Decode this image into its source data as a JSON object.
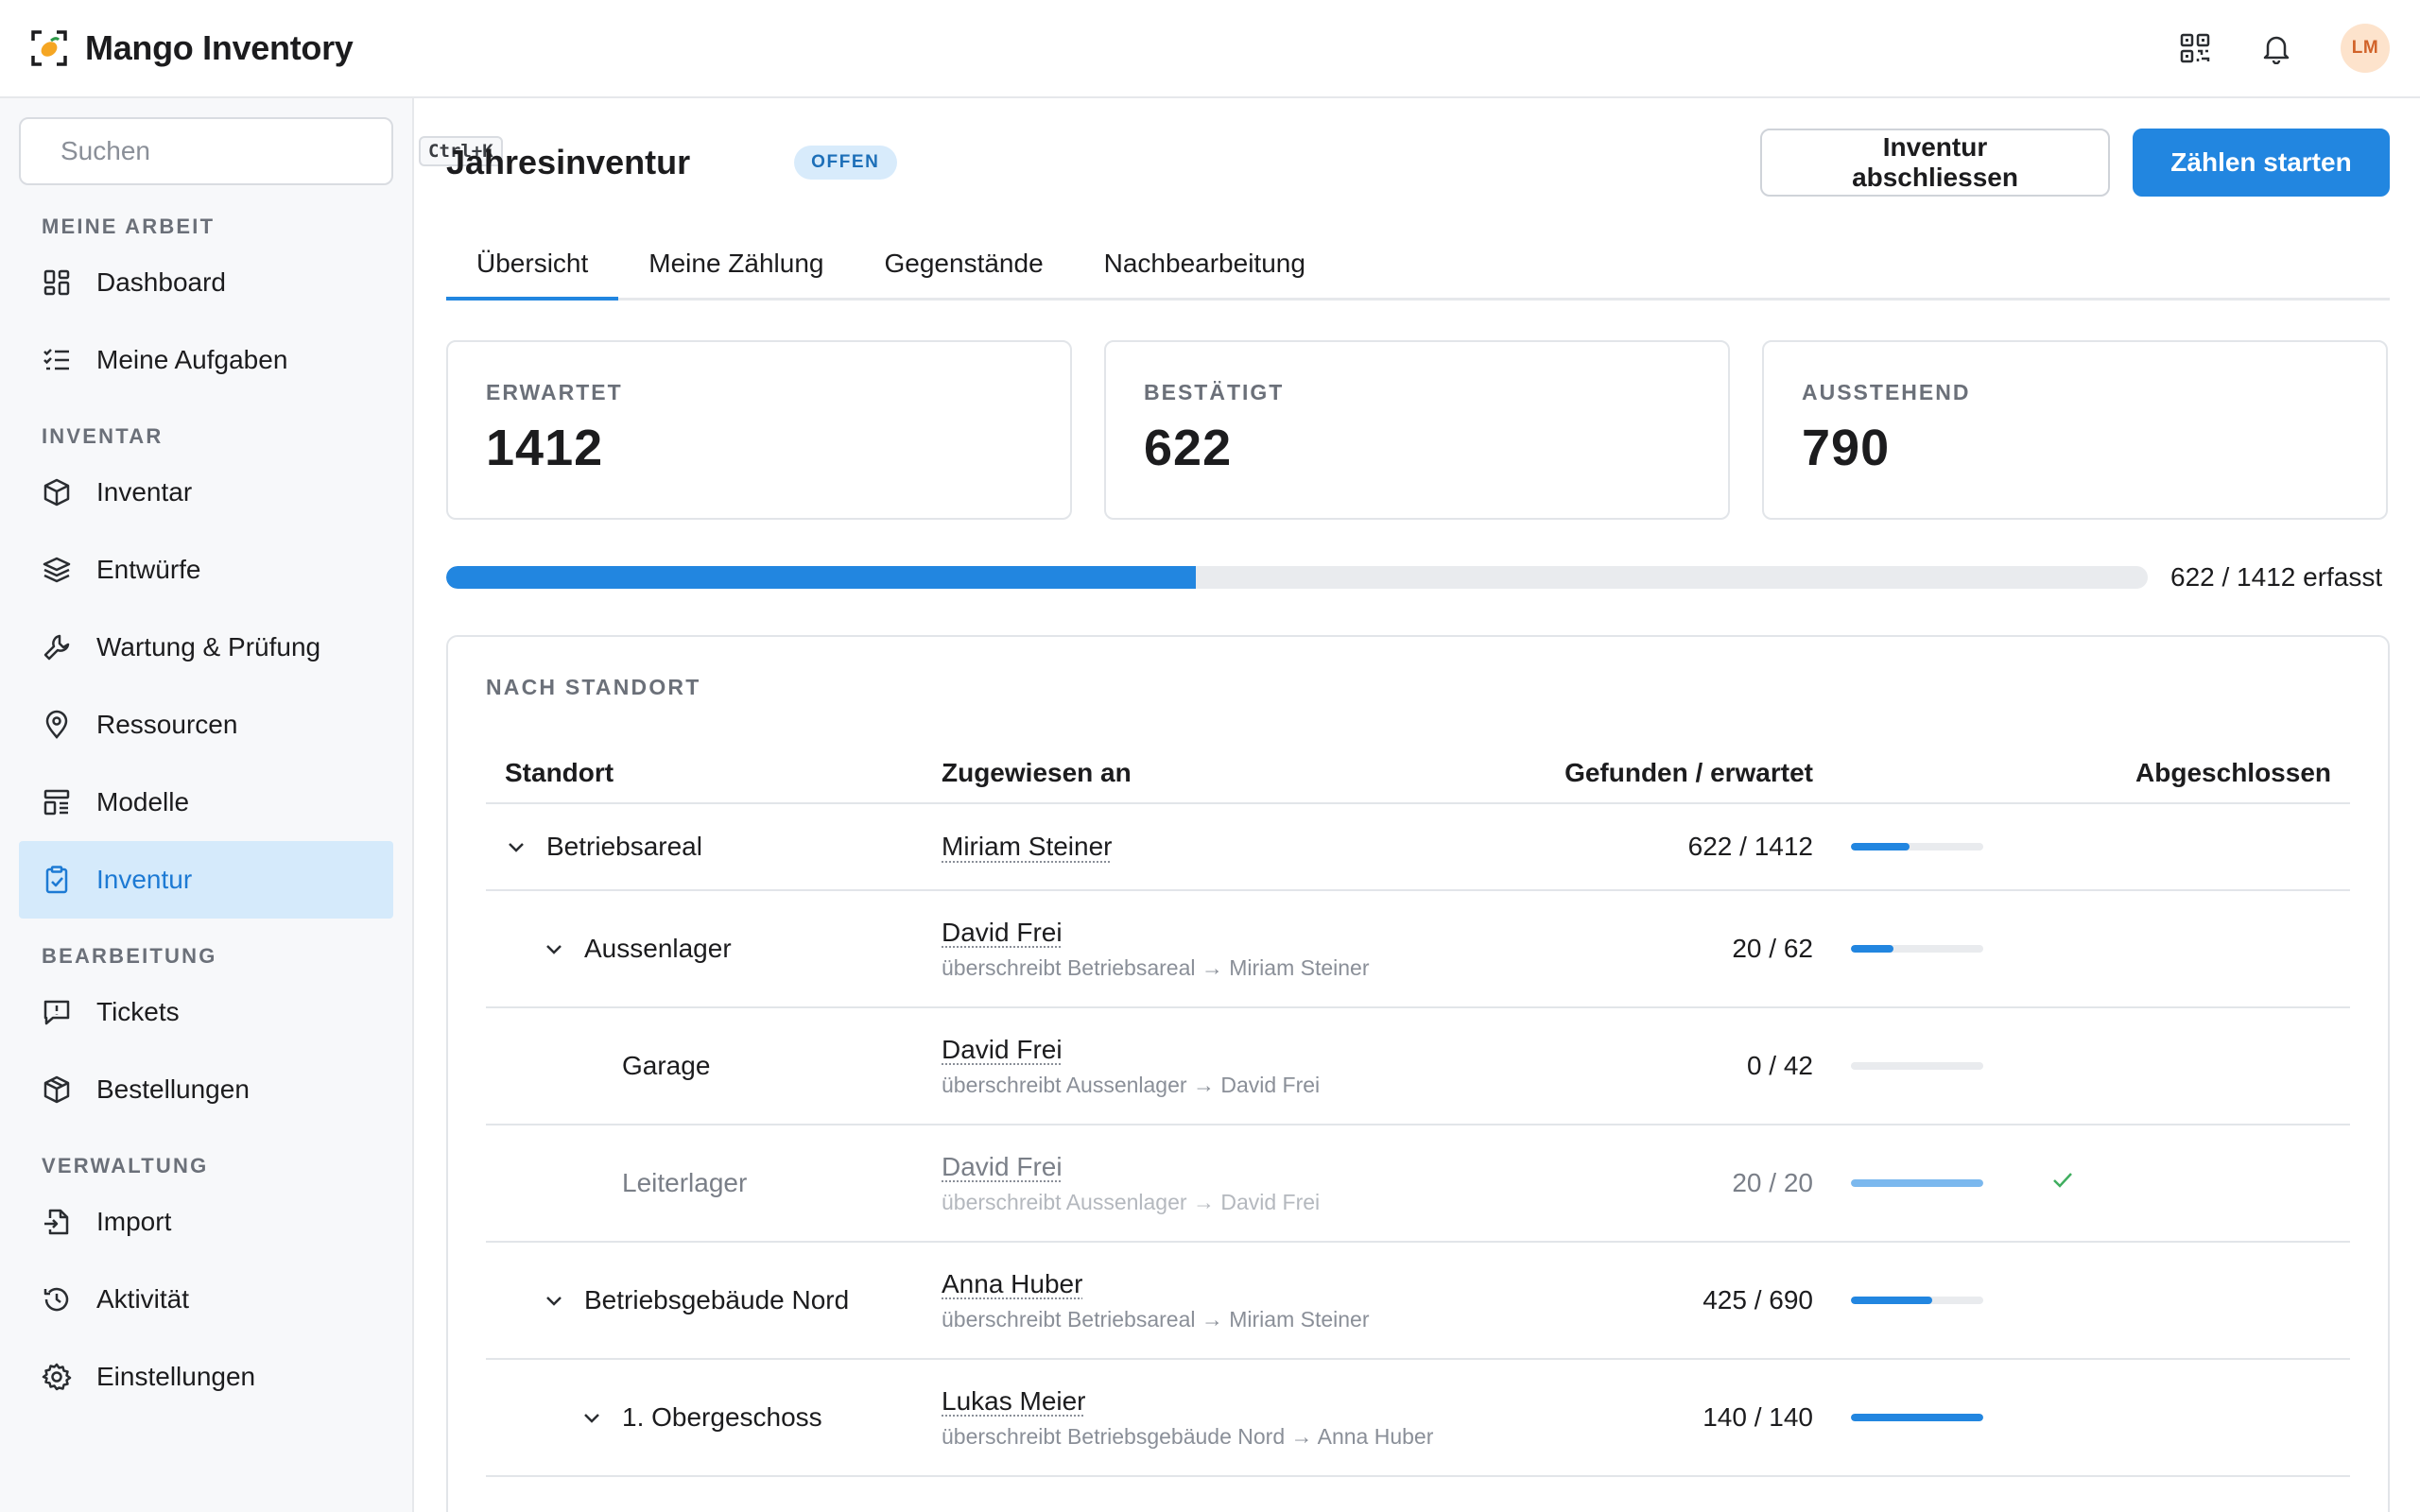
{
  "app": {
    "name": "Mango Inventory",
    "user_initials": "LM"
  },
  "topbar": {
    "icons": [
      "qr-code-icon",
      "bell-icon"
    ]
  },
  "search": {
    "placeholder": "Suchen",
    "shortcut": "Ctrl+K"
  },
  "sidebar": {
    "sections": [
      {
        "label": "MEINE ARBEIT",
        "items": [
          {
            "label": "Dashboard",
            "icon": "dashboard-icon"
          },
          {
            "label": "Meine Aufgaben",
            "icon": "checklist-icon"
          }
        ]
      },
      {
        "label": "INVENTAR",
        "items": [
          {
            "label": "Inventar",
            "icon": "box-icon"
          },
          {
            "label": "Entwürfe",
            "icon": "layers-icon"
          },
          {
            "label": "Wartung & Prüfung",
            "icon": "wrench-icon"
          },
          {
            "label": "Ressourcen",
            "icon": "location-pin-icon"
          },
          {
            "label": "Modelle",
            "icon": "template-icon"
          },
          {
            "label": "Inventur",
            "icon": "clipboard-check-icon",
            "active": true
          }
        ]
      },
      {
        "label": "BEARBEITUNG",
        "items": [
          {
            "label": "Tickets",
            "icon": "message-alert-icon"
          },
          {
            "label": "Bestellungen",
            "icon": "package-icon"
          }
        ]
      },
      {
        "label": "VERWALTUNG",
        "items": [
          {
            "label": "Import",
            "icon": "file-import-icon"
          },
          {
            "label": "Aktivität",
            "icon": "history-icon"
          },
          {
            "label": "Einstellungen",
            "icon": "gear-icon"
          }
        ]
      }
    ]
  },
  "page": {
    "title": "Jahresinventur",
    "status": "OFFEN",
    "actions": {
      "close": "Inventur abschliessen",
      "start": "Zählen starten"
    },
    "tabs": [
      "Übersicht",
      "Meine Zählung",
      "Gegenstände",
      "Nachbearbeitung"
    ],
    "active_tab": 0
  },
  "stats": [
    {
      "label": "ERWARTET",
      "value": "1412"
    },
    {
      "label": "BESTÄTIGT",
      "value": "622"
    },
    {
      "label": "AUSSTEHEND",
      "value": "790"
    }
  ],
  "progress": {
    "found": 622,
    "expected": 1412,
    "text": "622 / 1412 erfasst"
  },
  "locations": {
    "title": "NACH STANDORT",
    "columns": {
      "location": "Standort",
      "assigned": "Zugewiesen an",
      "count": "Gefunden / erwartet",
      "done": "Abgeschlossen"
    },
    "rows": [
      {
        "name": "Betriebsareal",
        "level": 0,
        "expandable": true,
        "assignee": "Miriam Steiner",
        "note": "",
        "count": "622 / 1412",
        "found": 622,
        "expected": 1412,
        "done": false,
        "faded": false
      },
      {
        "name": "Aussenlager",
        "level": 1,
        "expandable": true,
        "assignee": "David Frei",
        "note": "überschreibt Betriebsareal → Miriam Steiner",
        "count": "20 / 62",
        "found": 20,
        "expected": 62,
        "done": false,
        "faded": false
      },
      {
        "name": "Garage",
        "level": 2,
        "expandable": false,
        "assignee": "David Frei",
        "note": "überschreibt Aussenlager → David Frei",
        "count": "0 / 42",
        "found": 0,
        "expected": 42,
        "done": false,
        "faded": false
      },
      {
        "name": "Leiterlager",
        "level": 2,
        "expandable": false,
        "assignee": "David Frei",
        "note": "überschreibt Aussenlager → David Frei",
        "count": "20 / 20",
        "found": 20,
        "expected": 20,
        "done": true,
        "faded": true
      },
      {
        "name": "Betriebsgebäude Nord",
        "level": 1,
        "expandable": true,
        "assignee": "Anna Huber",
        "note": "überschreibt Betriebsareal → Miriam Steiner",
        "count": "425 / 690",
        "found": 425,
        "expected": 690,
        "done": false,
        "faded": false
      },
      {
        "name": "1. Obergeschoss",
        "level": 2,
        "expandable": true,
        "assignee": "Lukas Meier",
        "note": "überschreibt Betriebsgebäude Nord → Anna Huber",
        "count": "140 / 140",
        "found": 140,
        "expected": 140,
        "done": false,
        "faded": false
      }
    ]
  },
  "colors": {
    "accent": "#2286e0",
    "active_nav_bg": "#d5eafb",
    "badge_bg": "#d8ebfb",
    "check": "#3fae5f"
  }
}
